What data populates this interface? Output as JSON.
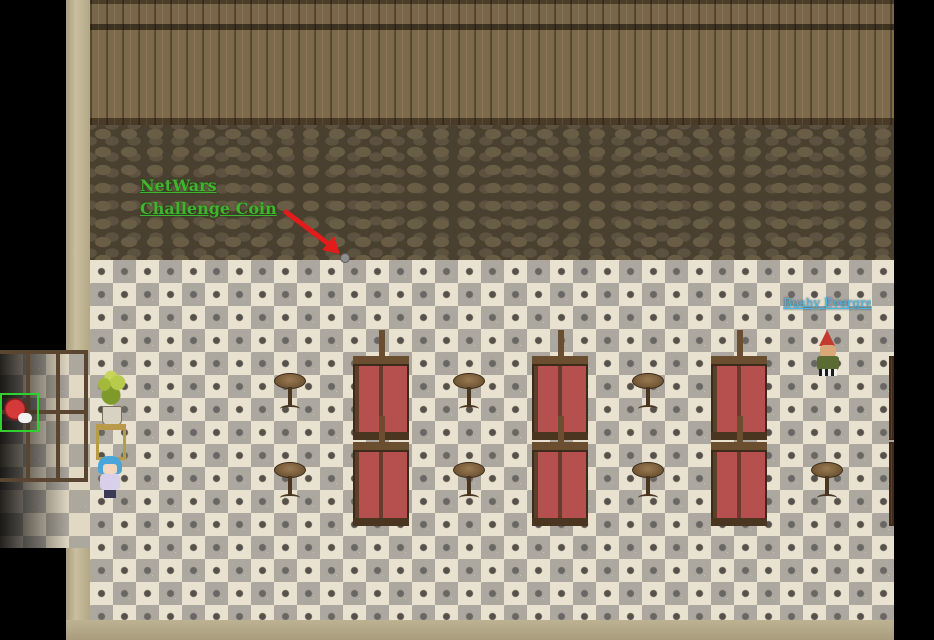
{
  "scene": {
    "name": "tavern-interior"
  },
  "callout": {
    "line1": "NetWars",
    "line2": "Challenge Coin",
    "color": "#3fb52e",
    "arrow_color": "#e21b1b"
  },
  "npc": {
    "name_label": "Bushy Evergreen",
    "label_color": "#46b8e8"
  },
  "inventory": {
    "selected_slot_color": "#2fd12f",
    "item_icon": "hat-icon"
  }
}
